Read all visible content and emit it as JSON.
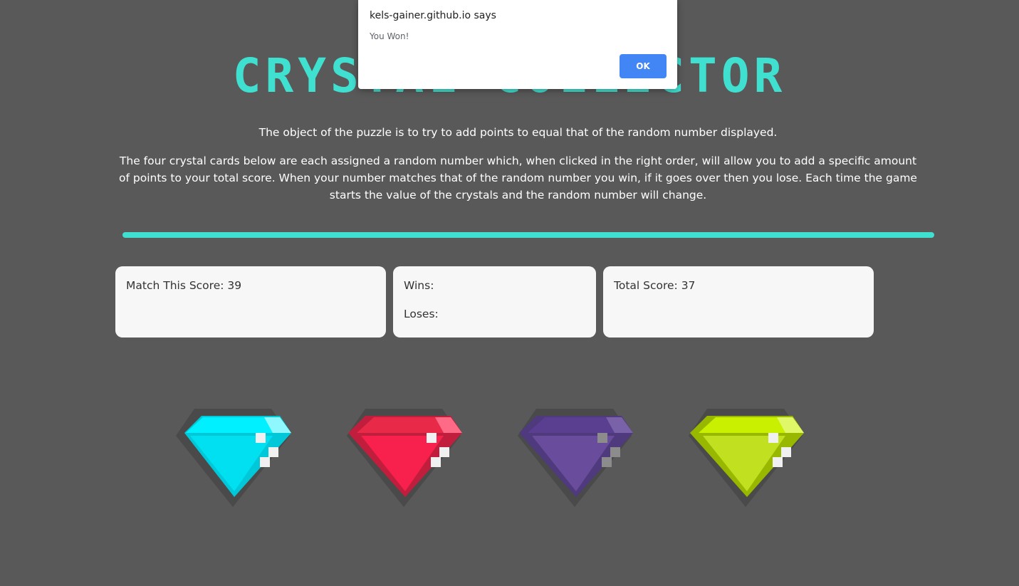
{
  "dialog": {
    "origin": "kels-gainer.github.io says",
    "message": "You Won!",
    "ok_label": "OK"
  },
  "header": {
    "title": "CRYSTAL COLLECTOR"
  },
  "intro": {
    "paragraph1": "The object of the puzzle is to try to add points to equal that of the random number displayed.",
    "paragraph2": "The four crystal cards below are each assigned a random number which, when clicked in the right order, will allow you to add a specific amount of points to your total score. When your number matches that of the random number you win, if it goes over then you lose. Each time the game starts the value of the crystals and the random number will change."
  },
  "scoreboard": {
    "target_label": "Match This Score: 39",
    "wins_label": "Wins:",
    "losses_label": "Loses:",
    "total_label": "Total Score: 37"
  },
  "colors": {
    "background": "#595959",
    "accent": "#40e0d0",
    "crystal_cyan": "#00f0ff",
    "crystal_red": "#f0284e",
    "crystal_purple": "#6a4c9c",
    "crystal_yellow": "#c8f000"
  },
  "crystals": [
    {
      "name": "cyan-crystal",
      "icon": "gem-icon"
    },
    {
      "name": "red-crystal",
      "icon": "gem-icon"
    },
    {
      "name": "purple-crystal",
      "icon": "gem-icon"
    },
    {
      "name": "yellow-crystal",
      "icon": "gem-icon"
    }
  ]
}
